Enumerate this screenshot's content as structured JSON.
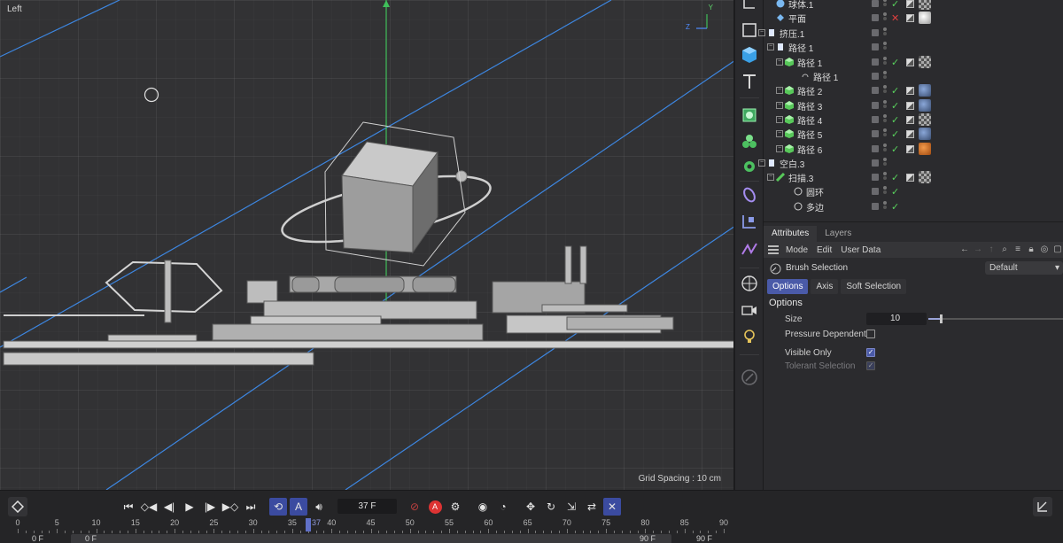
{
  "viewport": {
    "label": "Left",
    "grid_spacing": "Grid Spacing : 10 cm",
    "axis_y": "Y",
    "axis_z": "Z"
  },
  "object_manager": {
    "rows": [
      {
        "name": "球体.1",
        "status": "check"
      },
      {
        "name": "平面",
        "status": "x"
      },
      {
        "name": "挤压.1",
        "status": "none"
      },
      {
        "name": "路径 1",
        "status": "none"
      },
      {
        "name": "路径 1",
        "status": "check"
      },
      {
        "name": "路径 1",
        "status": "none"
      },
      {
        "name": "路径 2",
        "status": "check"
      },
      {
        "name": "路径 3",
        "status": "check"
      },
      {
        "name": "路径 4",
        "status": "check"
      },
      {
        "name": "路径 5",
        "status": "check"
      },
      {
        "name": "路径 6",
        "status": "check"
      },
      {
        "name": "空白.3",
        "status": "none"
      },
      {
        "name": "扫描.3",
        "status": "check"
      },
      {
        "name": "圆环",
        "status": "check"
      },
      {
        "name": "多边",
        "status": "check"
      }
    ]
  },
  "attributes": {
    "tabs": [
      "Attributes",
      "Layers"
    ],
    "menu": [
      "Mode",
      "Edit",
      "User Data"
    ],
    "tool_title": "Brush Selection",
    "preset": "Default",
    "subtabs": [
      "Options",
      "Axis",
      "Soft Selection"
    ],
    "section": "Options",
    "size_label": "Size",
    "size_value": "10",
    "pressure_label": "Pressure Dependent",
    "visible_only_label": "Visible Only",
    "tolerant_label": "Tolerant Selection"
  },
  "timeline": {
    "current_frame": "37 F",
    "playhead_label": "37",
    "ticks": [
      "0",
      "5",
      "10",
      "15",
      "20",
      "25",
      "30",
      "35",
      "40",
      "45",
      "50",
      "55",
      "60",
      "65",
      "70",
      "75",
      "80",
      "85",
      "90"
    ],
    "start_a": "0 F",
    "start_b": "0 F",
    "end_a": "90 F",
    "end_b": "90 F"
  },
  "colors": {
    "accent": "#4a5aa8",
    "check": "#58d05c",
    "cross": "#e04040",
    "spline": "#3d86e0",
    "y_axis": "#3fbf5a"
  }
}
